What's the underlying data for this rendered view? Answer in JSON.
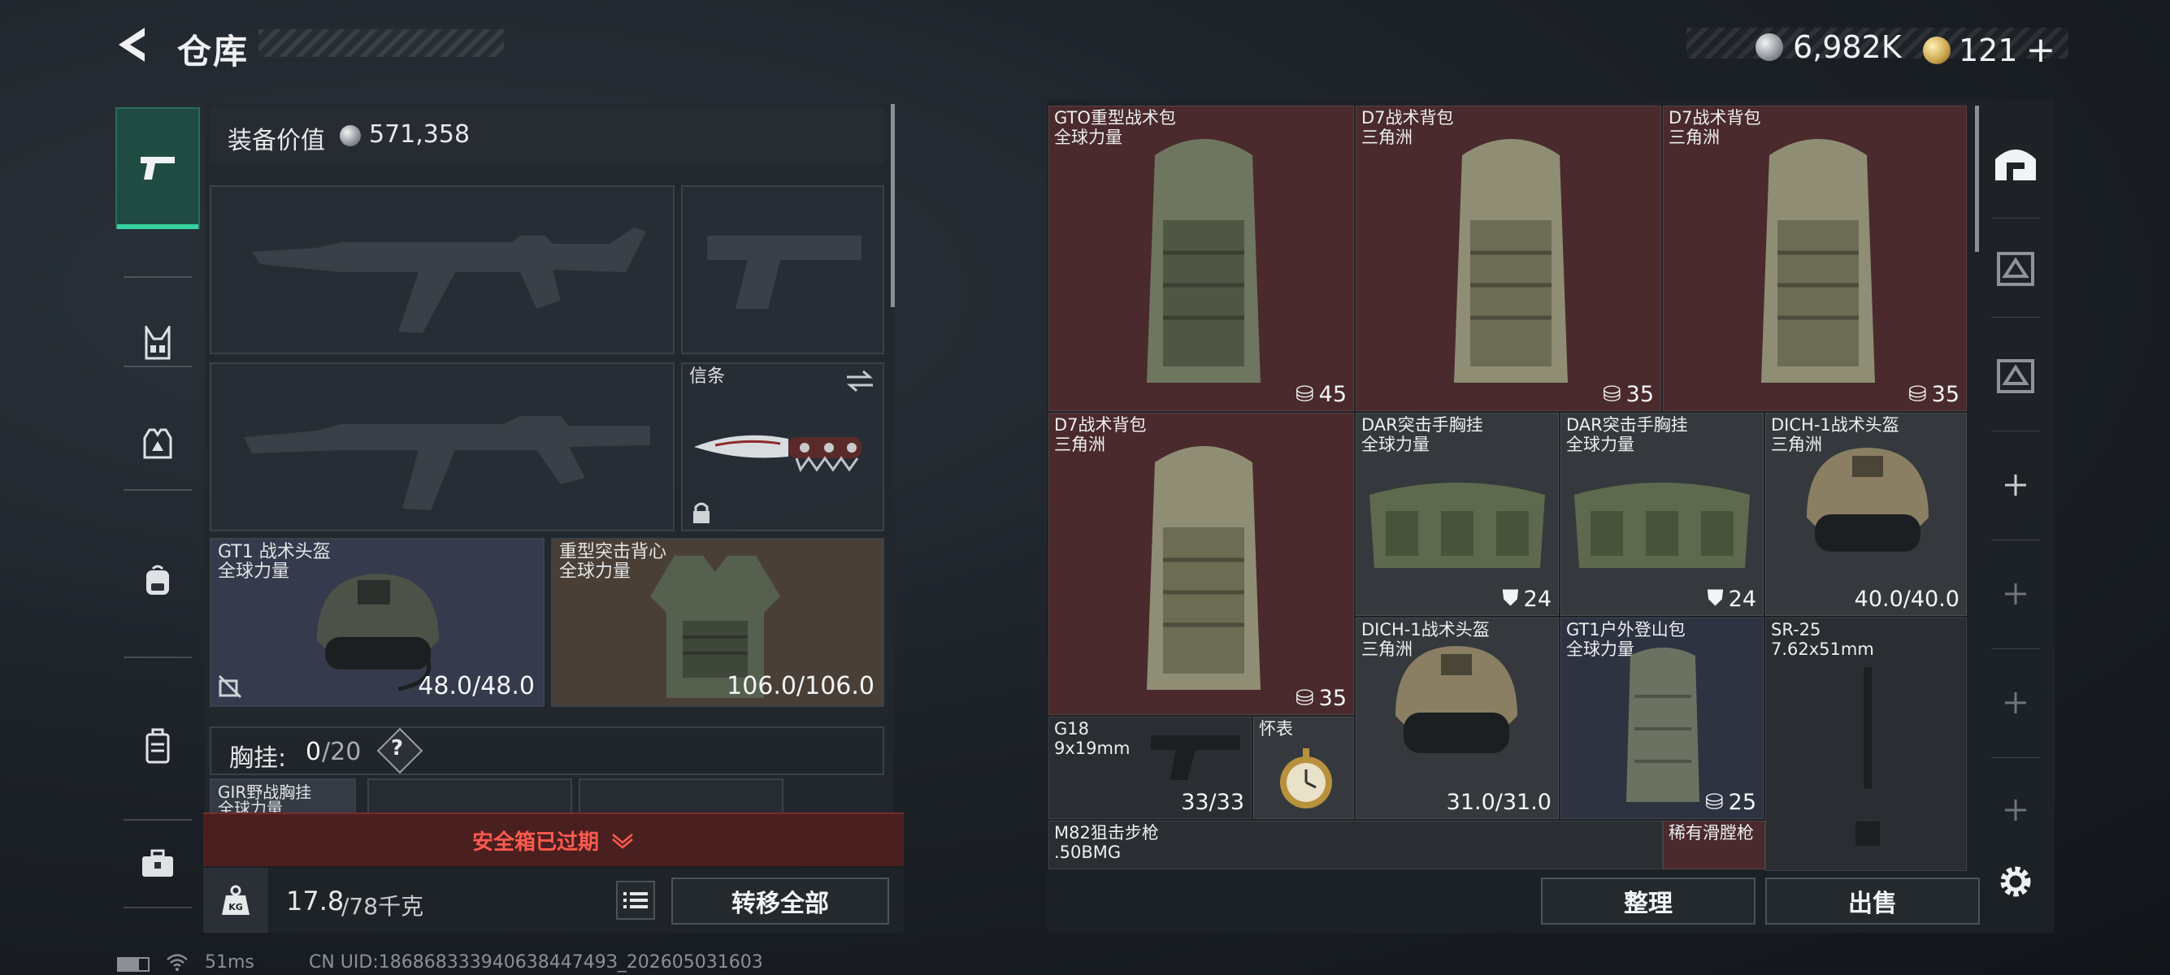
{
  "header": {
    "title": "仓库",
    "currency_main": "6,982K",
    "currency_premium": "121",
    "plus": "+"
  },
  "loadout": {
    "value_label": "装备价值",
    "value": "571,358",
    "melee_label": "信条",
    "helmet": {
      "name": "GT1 战术头盔",
      "origin": "全球力量",
      "durability": "48.0/48.0"
    },
    "armor": {
      "name": "重型突击背心",
      "origin": "全球力量",
      "durability": "106.0/106.0"
    },
    "rig_label": "胸挂:",
    "rig_count": "0",
    "rig_capacity": "/20",
    "rig_help": "?",
    "rig_item": {
      "name": "GIR野战胸挂",
      "origin": "全球力量"
    },
    "secure_box": "安全箱已过期"
  },
  "bottom": {
    "weight": "17.8",
    "weight_cap": "/78千克",
    "transfer_all": "转移全部"
  },
  "stash": {
    "items": [
      {
        "name": "GTO重型战术包",
        "origin": "全球力量",
        "value": "45"
      },
      {
        "name": "D7战术背包",
        "origin": "三角洲",
        "value": "35"
      },
      {
        "name": "D7战术背包",
        "origin": "三角洲",
        "value": "35"
      },
      {
        "name": "D7战术背包",
        "origin": "三角洲",
        "value": "35"
      },
      {
        "name": "DAR突击手胸挂",
        "origin": "全球力量",
        "value": "24"
      },
      {
        "name": "DAR突击手胸挂",
        "origin": "全球力量",
        "value": "24"
      },
      {
        "name": "DICH-1战术头盔",
        "origin": "三角洲",
        "value": "40.0/40.0"
      },
      {
        "name": "DICH-1战术头盔",
        "origin": "三角洲",
        "value": "31.0/31.0"
      },
      {
        "name": "GT1户外登山包",
        "origin": "全球力量",
        "value": "25"
      },
      {
        "name": "SR-25",
        "origin": "7.62x51mm"
      },
      {
        "name": "G18",
        "origin": "9x19mm",
        "value": "33/33"
      },
      {
        "name": "怀表"
      },
      {
        "name": "M82狙击步枪",
        "origin": ".50BMG"
      },
      {
        "name": "稀有滑膛枪"
      }
    ],
    "sort_label": "整理",
    "sell_label": "出售"
  },
  "status": {
    "ping": "51ms",
    "uid": "CN UID:18686833394063844749З_202605031603"
  }
}
